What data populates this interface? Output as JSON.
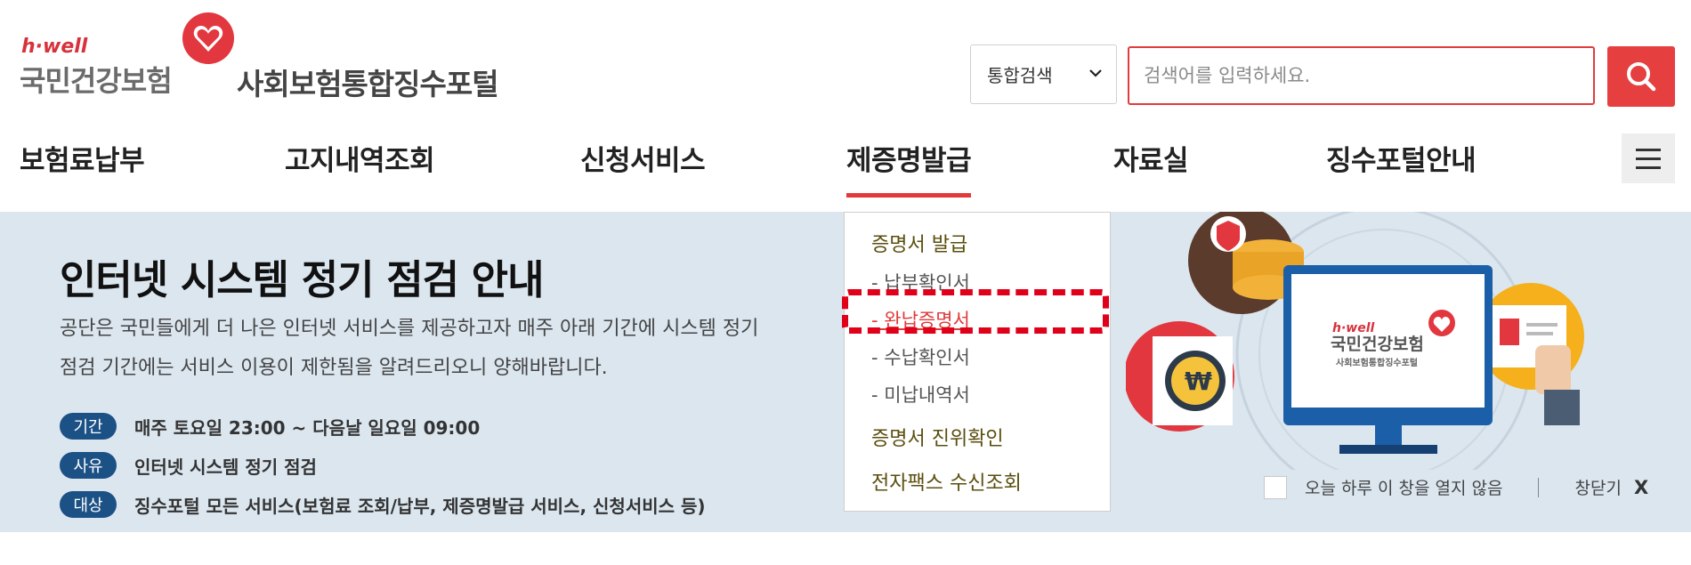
{
  "header": {
    "logo_hwell": "h·well",
    "logo_org": "국민건강보험",
    "logo_portal": "사회보험통합징수포털"
  },
  "search": {
    "select_value": "통합검색",
    "placeholder": "검색어를 입력하세요."
  },
  "nav": {
    "items": [
      "보험료납부",
      "고지내역조회",
      "신청서비스",
      "제증명발급",
      "자료실",
      "징수포털안내"
    ]
  },
  "dropdown": {
    "section1": "증명서 발급",
    "items": [
      "- 납부확인서",
      "- 완납증명서",
      "- 수납확인서",
      "- 미납내역서"
    ],
    "section2": "증명서 진위확인",
    "section3": "전자팩스 수신조회"
  },
  "banner": {
    "title": "인터넷 시스템 정기 점검 안내",
    "desc_line1": "공단은 국민들에게 더 나은 인터넷 서비스를 제공하고자 매주 아래 기간에 시스템 정기",
    "desc_line2": "점검 기간에는 서비스 이용이 제한됨을 알려드리오니 양해바랍니다.",
    "info": [
      {
        "badge": "기간",
        "text": "매주 토요일 23:00 ~ 다음날 일요일 09:00"
      },
      {
        "badge": "사유",
        "text": "인터넷 시스템 정기 점검"
      },
      {
        "badge": "대상",
        "text": "징수포털 모든 서비스(보험료 조회/납부, 제증명발급 서비스, 신청서비스 등)"
      }
    ],
    "dont_show_today": "오늘 하루 이 창을 열지 않음",
    "close_label": "창닫기",
    "close_x": "X",
    "illust_hwell": "h·well",
    "illust_org": "국민건강보험",
    "illust_portal": "사회보험통합징수포털",
    "illust_coin": "₩"
  },
  "colors": {
    "accent_red": "#e63f3f",
    "badge_blue": "#1c5186",
    "banner_bg": "#dbe6ef"
  },
  "icons": {
    "search": "search-icon",
    "menu": "hamburger-menu-icon",
    "heart": "heart-logo-icon",
    "caret": "chevron-down-icon"
  }
}
